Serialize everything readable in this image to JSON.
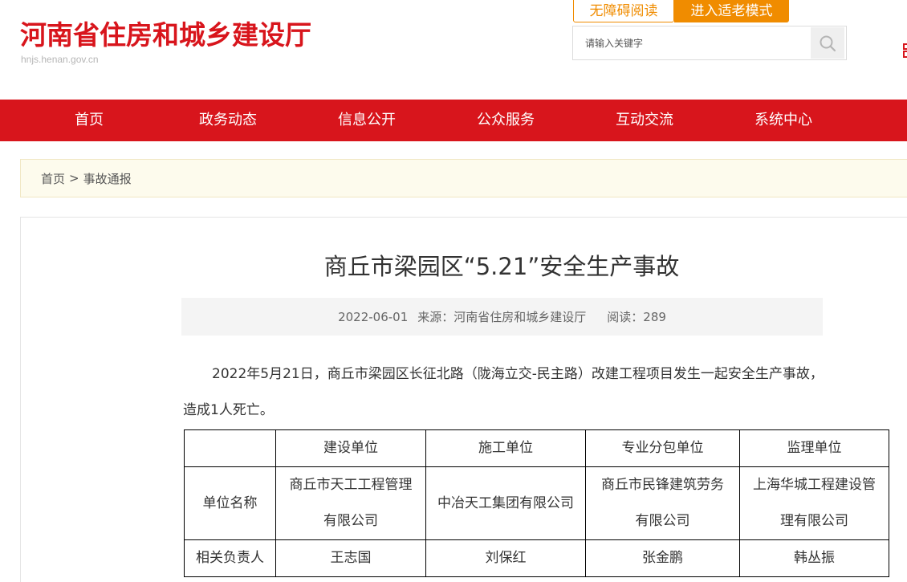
{
  "site": {
    "title": "河南省住房和城乡建设厅",
    "domain": "hnjs.henan.gov.cn"
  },
  "top_buttons": {
    "accessible": "无障碍阅读",
    "elder_mode": "进入适老模式"
  },
  "search": {
    "placeholder": "请输入关键字",
    "icon": "search-icon"
  },
  "nav": {
    "items": [
      {
        "label": "首页"
      },
      {
        "label": "政务动态"
      },
      {
        "label": "信息公开"
      },
      {
        "label": "公众服务"
      },
      {
        "label": "互动交流"
      },
      {
        "label": "系统中心"
      }
    ]
  },
  "breadcrumb": {
    "home": "首页",
    "separator": ">",
    "current": "事故通报"
  },
  "article": {
    "title": "商丘市梁园区“5.21”安全生产事故",
    "date": "2022-06-01",
    "source": "来源：河南省住房和城乡建设厅",
    "reads": "阅读：289",
    "paragraph": "2022年5月21日，商丘市梁园区长征北路（陇海立交-民主路）改建工程项目发生一起安全生产事故，造成1人死亡。"
  },
  "table": {
    "headers": [
      "",
      "建设单位",
      "施工单位",
      "专业分包单位",
      "监理单位"
    ],
    "rows": [
      {
        "label": "单位名称",
        "cells": [
          [
            "商丘市天工工程管理",
            "有限公司"
          ],
          [
            "中冶天工集团有限公司"
          ],
          [
            "商丘市民锋建筑劳务",
            "有限公司"
          ],
          [
            "上海华城工程建设管",
            "理有限公司"
          ]
        ]
      },
      {
        "label": "相关负责人",
        "cells": [
          [
            "王志国"
          ],
          [
            "刘保红"
          ],
          [
            "张金鹏"
          ],
          [
            "韩丛振"
          ]
        ]
      }
    ]
  },
  "colors": {
    "brand_red": "#d8151c",
    "accent_orange": "#f08c00",
    "breadcrumb_bg": "#fdfbed",
    "meta_bg": "#f4f4f4"
  }
}
